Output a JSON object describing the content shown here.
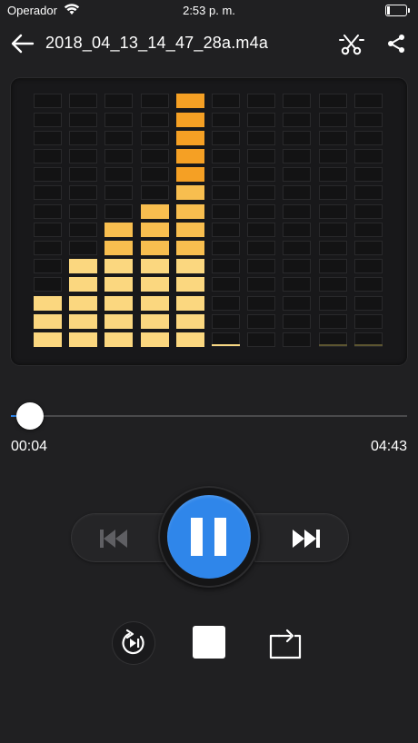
{
  "status_bar": {
    "carrier": "Operador",
    "time": "2:53 p. m."
  },
  "nav": {
    "title": "2018_04_13_14_47_28a.m4a"
  },
  "visualizer": {
    "columns": 10,
    "rows": 14,
    "lit_rows_per_column": [
      3,
      5,
      7,
      8,
      14,
      0,
      0,
      0,
      0,
      0
    ],
    "accent_colors": {
      "yellow": "#fbd77f",
      "gold": "#f8be4f",
      "orange": "#f5a024"
    }
  },
  "player": {
    "elapsed": "00:04",
    "total": "04:43",
    "progress_fraction": 0.014,
    "accent_color": "#2f86ea"
  },
  "controls": {
    "back_icon": "arrow-left-icon",
    "trim_icon": "scissors-icon",
    "share_icon": "share-icon",
    "prev_icon": "previous-track-icon",
    "pause_icon": "pause-icon",
    "next_icon": "next-track-icon",
    "loop_icon": "loop-play-icon",
    "stop_icon": "stop-icon",
    "repeat_icon": "repeat-icon"
  }
}
